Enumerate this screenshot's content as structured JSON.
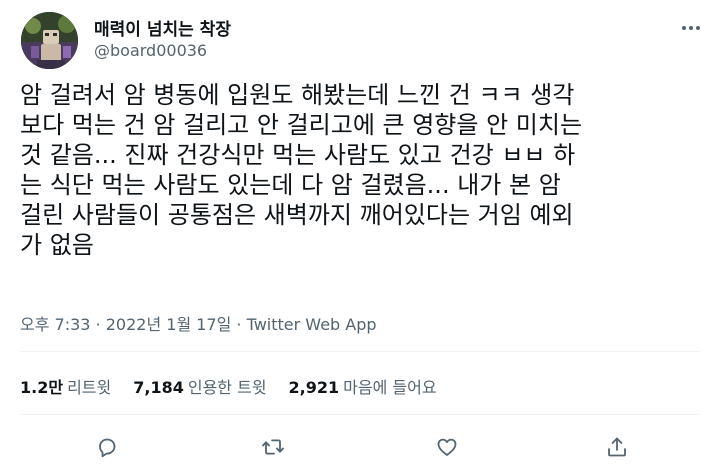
{
  "user": {
    "display_name": "매력이 넘치는 착장",
    "handle": "@board00036"
  },
  "tweet": {
    "lines": [
      "암 걸려서 암 병동에 입원도 해봤는데 느낀 건 ㅋㅋ 생각",
      "보다 먹는 건 암 걸리고 안 걸리고에 큰 영향을 안 미치는",
      "것 같음... 진짜 건강식만 먹는 사람도 있고 건강 ㅂㅂ 하",
      "는 식단 먹는 사람도 있는데 다 암 걸렸음... 내가 본 암",
      "걸린 사람들이 공통점은 새벽까지 깨어있다는 거임 예외",
      "가 없음"
    ]
  },
  "meta": {
    "time": "오후 7:33",
    "sep1": " · ",
    "date": "2022년 1월 17일",
    "sep2": " · ",
    "source": "Twitter Web App"
  },
  "stats": {
    "retweets_count": "1.2만",
    "retweets_label": "리트윗",
    "quotes_count": "7,184",
    "quotes_label": "인용한 트윗",
    "likes_count": "2,921",
    "likes_label": "마음에 들어요"
  },
  "icons": {
    "more": "more-icon",
    "reply": "reply-icon",
    "retweet": "retweet-icon",
    "like": "heart-icon",
    "share": "share-icon"
  },
  "colors": {
    "text": "#0f1419",
    "secondary": "#536471",
    "divider": "#eff3f4"
  }
}
